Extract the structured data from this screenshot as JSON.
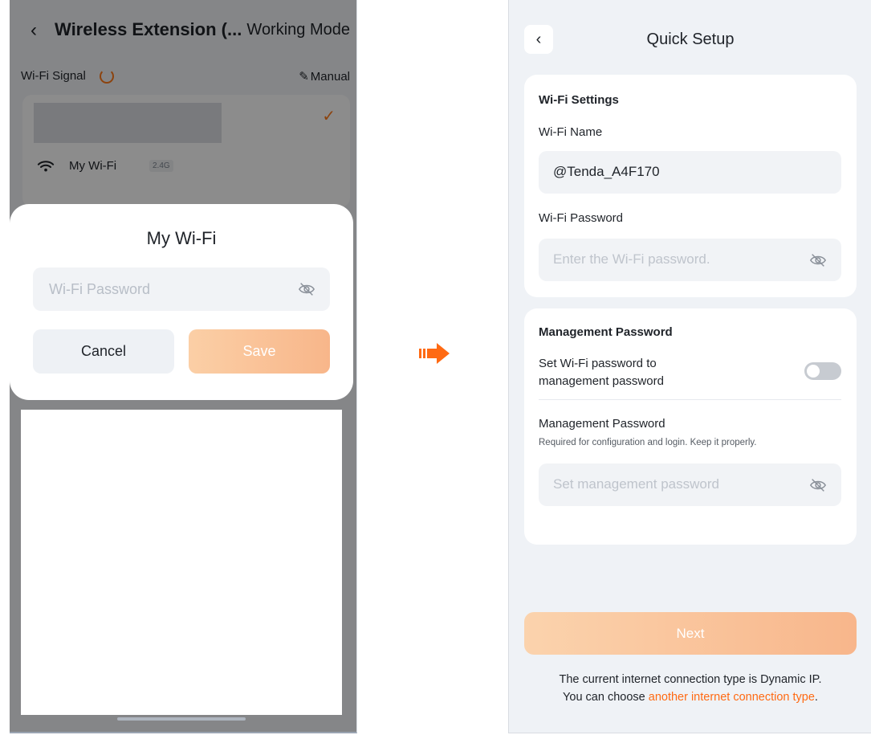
{
  "left_screen": {
    "back_glyph": "‹",
    "title": "Wireless Extension (...",
    "mode_label": "Working Mode",
    "signal_label": "Wi-Fi Signal",
    "manual_label": "Manual",
    "selected_check": "✓",
    "network": {
      "name": "My Wi-Fi",
      "band": "2.4G"
    },
    "dialog": {
      "title": "My Wi-Fi",
      "password_placeholder": "Wi-Fi Password",
      "cancel_label": "Cancel",
      "save_label": "Save"
    }
  },
  "right_screen": {
    "back_glyph": "‹",
    "title": "Quick Setup",
    "wifi_settings": {
      "section_title": "Wi-Fi Settings",
      "name_label": "Wi-Fi Name",
      "name_value": "@Tenda_A4F170",
      "password_label": "Wi-Fi Password",
      "password_placeholder": "Enter the Wi-Fi password."
    },
    "management": {
      "section_title": "Management Password",
      "toggle_label": "Set Wi-Fi password to management password",
      "toggle_on": false,
      "password_label": "Management Password",
      "hint": "Required for configuration and login. Keep it properly.",
      "password_placeholder": "Set management password"
    },
    "next_label": "Next",
    "footer_line1": "The current internet connection type is Dynamic IP.",
    "footer_prefix": "You can choose ",
    "footer_link": "another internet connection type",
    "footer_suffix": "."
  },
  "colors": {
    "accent": "#ff7a1a",
    "link": "#ff6a13",
    "button_gradient_start": "#fbd3ad",
    "button_gradient_end": "#f8b68b"
  },
  "icons": [
    "back-chevron-icon",
    "refresh-icon",
    "edit-pencil-icon",
    "checkmark-icon",
    "wifi-icon",
    "eye-off-icon",
    "flow-arrow-icon"
  ]
}
